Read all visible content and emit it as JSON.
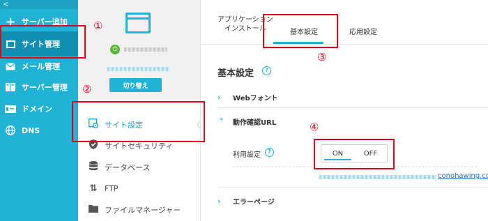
{
  "nav": {
    "collapse_glyph": "<",
    "items": [
      {
        "label": "サーバー追加",
        "icon": "plus-icon"
      },
      {
        "label": "サイト管理",
        "icon": "window-icon"
      },
      {
        "label": "メール管理",
        "icon": "mail-icon"
      },
      {
        "label": "サーバー管理",
        "icon": "server-icon"
      },
      {
        "label": "ドメイン",
        "icon": "domain-tag-icon"
      },
      {
        "label": "DNS",
        "icon": "globe-icon"
      }
    ]
  },
  "sub": {
    "switch_label": "切り替え",
    "items": [
      {
        "label": "サイト設定",
        "icon": "site-settings-icon"
      },
      {
        "label": "サイトセキュリティ",
        "icon": "shield-icon"
      },
      {
        "label": "データベース",
        "icon": "database-icon"
      },
      {
        "label": "FTP",
        "icon": "ftp-arrows-icon"
      },
      {
        "label": "ファイルマネージャー",
        "icon": "folder-icon"
      }
    ]
  },
  "tabs": {
    "app_install_line1": "アプリケーション",
    "app_install_line2": "インストール",
    "basic": "基本設定",
    "advanced": "応用設定"
  },
  "section": {
    "title": "基本設定",
    "help_glyph": "?"
  },
  "accordion": {
    "webfont": "Webフォント",
    "verify_url": "動作確認URL",
    "error_page": "エラーページ"
  },
  "usage": {
    "label": "利用設定",
    "on": "ON",
    "off": "OFF",
    "selected": "ON"
  },
  "url_suffix": "conohawing.com",
  "annotations": [
    "①",
    "②",
    "③",
    "④"
  ],
  "colors": {
    "accent": "#21b3d6",
    "nav_active": "#0f8fb2",
    "annotation": "#e0001b"
  }
}
